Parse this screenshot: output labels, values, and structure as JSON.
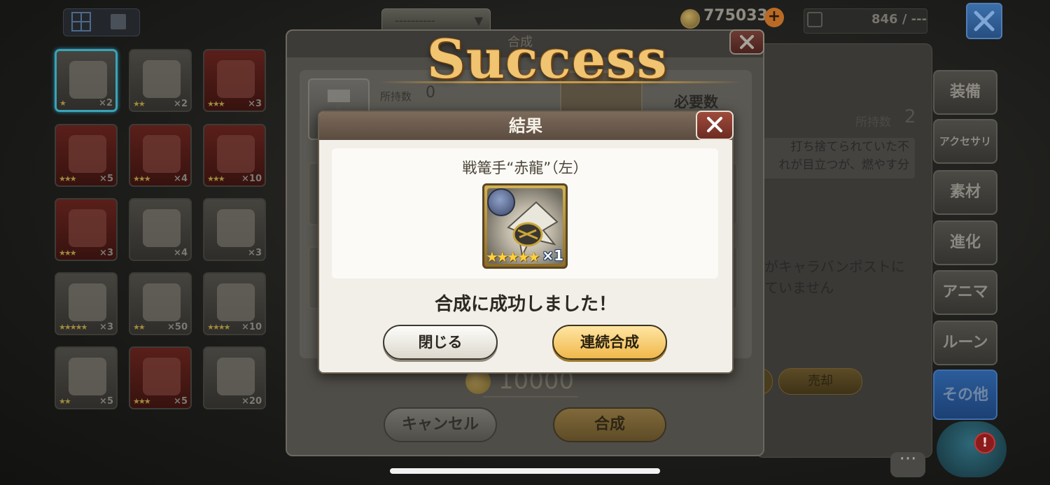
{
  "topbar": {
    "sort_label": "----------",
    "gold_amount": "775033",
    "gold_plus": "+",
    "capacity": "846 / ---"
  },
  "inventory": [
    {
      "stars": "★",
      "count": "×2",
      "tone": "grey"
    },
    {
      "stars": "★★",
      "count": "×2",
      "tone": "grey"
    },
    {
      "stars": "★★★",
      "count": "×3",
      "tone": "red"
    },
    {
      "stars": "★★★",
      "count": "×5",
      "tone": "red"
    },
    {
      "stars": "★★★",
      "count": "×4",
      "tone": "red"
    },
    {
      "stars": "★★★",
      "count": "×10",
      "tone": "red"
    },
    {
      "stars": "★★★",
      "count": "×3",
      "tone": "red"
    },
    {
      "stars": "",
      "count": "×4",
      "tone": "grey"
    },
    {
      "stars": "",
      "count": "×3",
      "tone": "grey"
    },
    {
      "stars": "★★★★★",
      "count": "×3",
      "tone": "grey"
    },
    {
      "stars": "★★",
      "count": "×50",
      "tone": "grey"
    },
    {
      "stars": "★★★★",
      "count": "×10",
      "tone": "grey"
    },
    {
      "stars": "★★",
      "count": "×5",
      "tone": "grey"
    },
    {
      "stars": "★★★",
      "count": "×5",
      "tone": "red"
    },
    {
      "stars": "",
      "count": "×20",
      "tone": "grey"
    }
  ],
  "side_tabs": [
    "装備",
    "アクセサリ",
    "素材",
    "進化",
    "アニマ",
    "ルーン",
    "その他"
  ],
  "detail": {
    "owned_label": "所持数",
    "owned_value": "2",
    "desc_line1": "打ち捨てられていた不",
    "desc_line2": "れが目立つが、燃やす分",
    "note_line1": "がキャラバンポストに",
    "note_line2": "ていません",
    "sell_label": "売却"
  },
  "synthesis": {
    "title": "合成",
    "owned_label": "所持数",
    "owned_value": "0",
    "required_label": "必要数",
    "cost": "10000",
    "cancel_label": "キャンセル",
    "synth_label": "合成"
  },
  "banner": {
    "text": "Success"
  },
  "result": {
    "title": "結果",
    "item_name": "戦篭手“赤龍”（左）",
    "item_stars": "★★★★★",
    "item_qty": "×1",
    "message": "合成に成功しました！",
    "close_label": "閉じる",
    "continue_label": "連続合成"
  },
  "chat_glyph": "···",
  "mascot_alert": "!",
  "colors": {
    "success_gold": "#f0c470",
    "result_header": "#7c6a5b",
    "continue_button": "#f0b84b",
    "active_tab": "#2b5c9a"
  }
}
